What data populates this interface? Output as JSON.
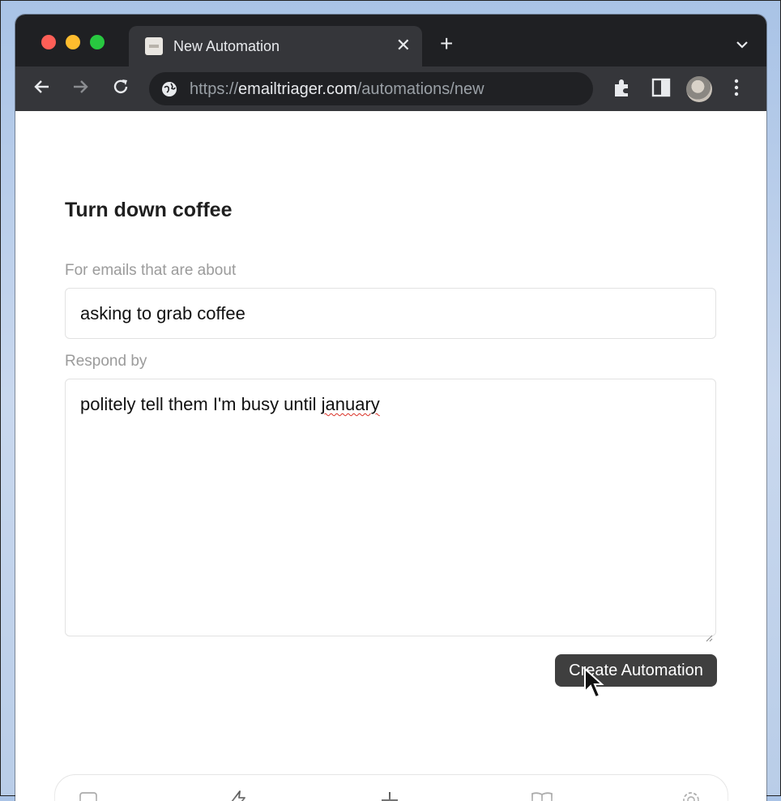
{
  "browser": {
    "tab": {
      "title": "New Automation",
      "close_icon": "close-icon"
    },
    "new_tab_label": "+",
    "address": {
      "scheme": "https://",
      "domain": "emailtriager.com",
      "path": "/automations/new"
    }
  },
  "page": {
    "title": "Turn down coffee",
    "about_label": "For emails that are about",
    "about_value": "asking to grab coffee",
    "respond_label": "Respond by",
    "respond_value_prefix": "politely tell them I'm busy until ",
    "respond_value_misspelled": "january",
    "create_button": "Create Automation"
  },
  "bottom_nav": {
    "items": [
      "inbox-icon",
      "bolt-icon",
      "plus-icon",
      "book-icon",
      "gear-icon"
    ]
  },
  "colors": {
    "titlebar": "#1f2023",
    "toolbar": "#35363a",
    "button_bg": "#3f3f3f"
  }
}
